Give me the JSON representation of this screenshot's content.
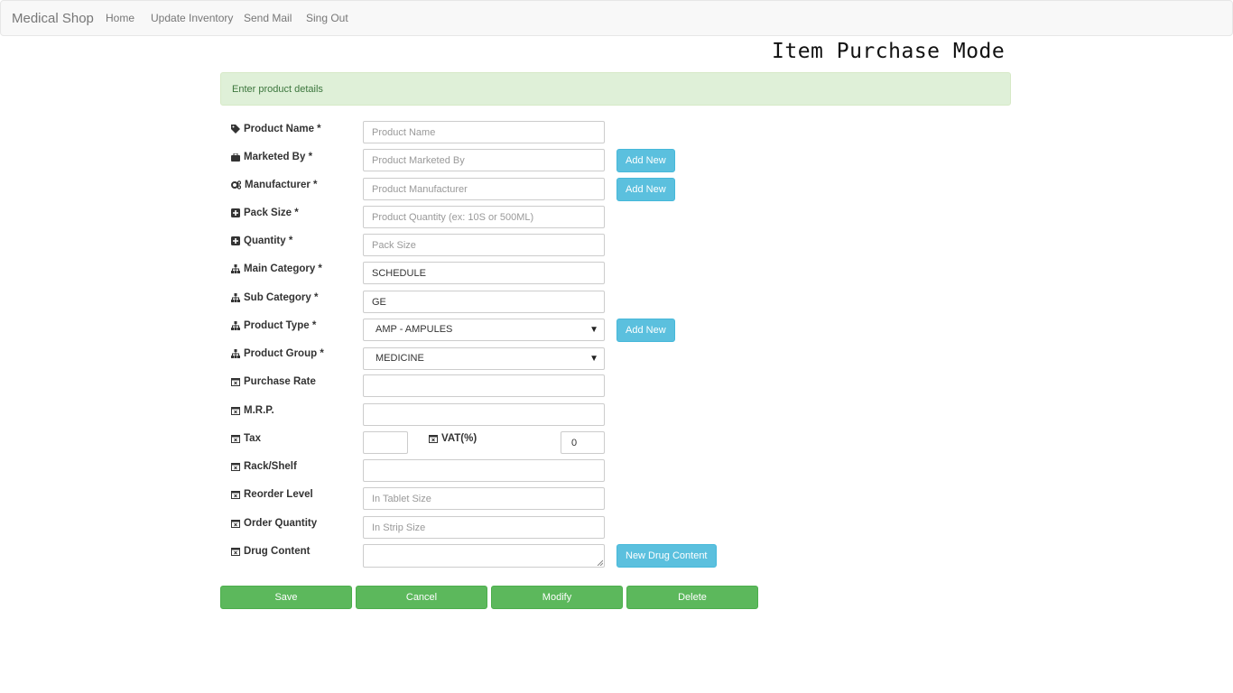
{
  "navbar": {
    "brand": "Medical Shop",
    "links": [
      "Home",
      "Update Inventory",
      "Send Mail",
      "Sing Out"
    ]
  },
  "page_title": "Item Purchase Mode",
  "alert": "Enter product details",
  "form": {
    "product_name": {
      "label": "Product Name *",
      "placeholder": "Product Name",
      "icon": "tag-icon"
    },
    "marketed_by": {
      "label": "Marketed By *",
      "placeholder": "Product Marketed By",
      "button": "Add New",
      "icon": "briefcase-icon"
    },
    "manufacturer": {
      "label": "Manufacturer *",
      "placeholder": "Product Manufacturer",
      "button": "Add New",
      "icon": "cogs-icon"
    },
    "pack_size": {
      "label": "Pack Size *",
      "placeholder": "Product Quantity (ex: 10S or 500ML)",
      "icon": "plus-square-icon"
    },
    "quantity": {
      "label": "Quantity *",
      "placeholder": "Pack Size",
      "icon": "plus-square-icon"
    },
    "main_category": {
      "label": "Main Category *",
      "value": "SCHEDULE",
      "icon": "sitemap-icon"
    },
    "sub_category": {
      "label": "Sub Category *",
      "value": "GE",
      "icon": "sitemap-icon"
    },
    "product_type": {
      "label": "Product Type *",
      "value": "AMP - AMPULES",
      "button": "Add New",
      "icon": "sitemap-icon"
    },
    "product_group": {
      "label": "Product Group *",
      "value": "MEDICINE",
      "icon": "sitemap-icon"
    },
    "purchase_rate": {
      "label": "Purchase Rate",
      "value": "",
      "icon": "calendar-icon"
    },
    "mrp": {
      "label": "M.R.P.",
      "value": "",
      "icon": "calendar-icon"
    },
    "tax": {
      "label": "Tax",
      "value": "",
      "icon": "calendar-icon"
    },
    "vat": {
      "label": "VAT(%)",
      "value": "0",
      "icon": "calendar-icon"
    },
    "rack_shelf": {
      "label": "Rack/Shelf",
      "value": "",
      "icon": "calendar-icon"
    },
    "reorder_level": {
      "label": "Reorder Level",
      "placeholder": "In Tablet Size",
      "icon": "calendar-icon"
    },
    "order_quantity": {
      "label": "Order Quantity",
      "placeholder": "In Strip Size",
      "icon": "calendar-icon"
    },
    "drug_content": {
      "label": "Drug Content",
      "value": "",
      "button": "New Drug Content",
      "icon": "calendar-icon"
    }
  },
  "actions": [
    "Save",
    "Cancel",
    "Modify",
    "Delete"
  ],
  "colors": {
    "alert_bg": "#dff0d8",
    "alert_text": "#3c763d",
    "info_button": "#5bc0de",
    "success_button": "#5cb85c"
  }
}
